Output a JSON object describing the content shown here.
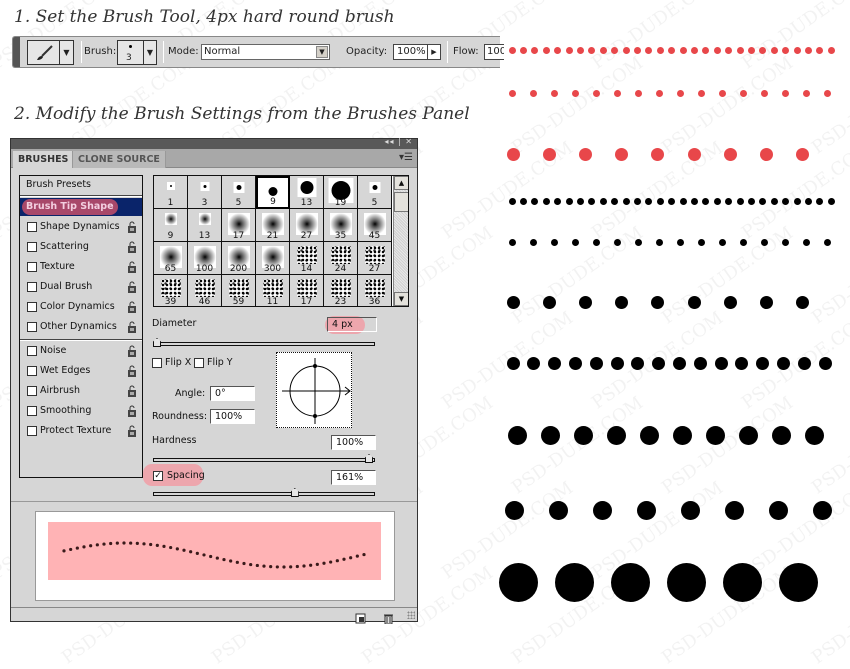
{
  "step1": {
    "title": "1. Set the Brush Tool, 4px hard round brush"
  },
  "step2": {
    "title": "2. Modify the Brush Settings from the Brushes Panel"
  },
  "options_bar": {
    "tool_icon": "brush-icon",
    "brush_label": "Brush:",
    "brush_size": "3",
    "mode_label": "Mode:",
    "mode_value": "Normal",
    "opacity_label": "Opacity:",
    "opacity_value": "100%",
    "flow_label": "Flow:",
    "flow_value": "100"
  },
  "panel": {
    "controls": "◂◂ | ✕",
    "tabs": [
      {
        "label": "BRUSHES",
        "active": true
      },
      {
        "label": "CLONE SOURCE",
        "active": false
      }
    ],
    "menu_icon": "panel-menu-icon",
    "presets_label": "Brush Presets",
    "selected_label": "Brush Tip Shape",
    "options": [
      {
        "label": "Shape Dynamics",
        "checked": false
      },
      {
        "label": "Scattering",
        "checked": false
      },
      {
        "label": "Texture",
        "checked": false
      },
      {
        "label": "Dual Brush",
        "checked": false
      },
      {
        "label": "Color Dynamics",
        "checked": false
      },
      {
        "label": "Other Dynamics",
        "checked": false
      },
      {
        "label": "Noise",
        "checked": false
      },
      {
        "label": "Wet Edges",
        "checked": false
      },
      {
        "label": "Airbrush",
        "checked": false
      },
      {
        "label": "Smoothing",
        "checked": false
      },
      {
        "label": "Protect Texture",
        "checked": false
      }
    ],
    "brush_tips": [
      {
        "size": "1",
        "kind": "hard"
      },
      {
        "size": "3",
        "kind": "hard"
      },
      {
        "size": "5",
        "kind": "hard"
      },
      {
        "size": "9",
        "kind": "hard",
        "selected": true
      },
      {
        "size": "13",
        "kind": "hard"
      },
      {
        "size": "19",
        "kind": "hard"
      },
      {
        "size": "5",
        "kind": "hard"
      },
      {
        "size": "9",
        "kind": "soft"
      },
      {
        "size": "13",
        "kind": "soft"
      },
      {
        "size": "17",
        "kind": "soft"
      },
      {
        "size": "21",
        "kind": "soft"
      },
      {
        "size": "27",
        "kind": "soft"
      },
      {
        "size": "35",
        "kind": "soft"
      },
      {
        "size": "45",
        "kind": "soft"
      },
      {
        "size": "65",
        "kind": "soft"
      },
      {
        "size": "100",
        "kind": "soft"
      },
      {
        "size": "200",
        "kind": "soft"
      },
      {
        "size": "300",
        "kind": "soft"
      },
      {
        "size": "14",
        "kind": "spatter"
      },
      {
        "size": "24",
        "kind": "spatter"
      },
      {
        "size": "27",
        "kind": "spatter"
      },
      {
        "size": "39",
        "kind": "spatter"
      },
      {
        "size": "46",
        "kind": "spatter"
      },
      {
        "size": "59",
        "kind": "spatter"
      },
      {
        "size": "11",
        "kind": "spatter"
      },
      {
        "size": "17",
        "kind": "spatter"
      },
      {
        "size": "23",
        "kind": "spatter"
      },
      {
        "size": "36",
        "kind": "spatter"
      }
    ],
    "diameter_label": "Diameter",
    "diameter_value": "4 px",
    "diameter_fraction": 0.0,
    "flip_x_label": "Flip X",
    "flip_y_label": "Flip Y",
    "angle_label": "Angle:",
    "angle_value": "0°",
    "roundness_label": "Roundness:",
    "roundness_value": "100%",
    "hardness_label": "Hardness",
    "hardness_value": "100%",
    "hardness_fraction": 1.0,
    "spacing_label": "Spacing",
    "spacing_checked": true,
    "spacing_value": "161%",
    "spacing_fraction": 0.65,
    "footer_icons": [
      "new-preset-icon",
      "trash-icon"
    ]
  },
  "samples": {
    "colors": {
      "red": "#e8474a",
      "black": "#000000"
    },
    "rows": [
      {
        "color": "red",
        "diameter": 4,
        "count": 29
      },
      {
        "color": "red",
        "diameter": 4,
        "count": 16
      },
      {
        "color": "red",
        "diameter": 9,
        "count": 9
      },
      {
        "color": "black",
        "diameter": 4,
        "count": 29
      },
      {
        "color": "black",
        "diameter": 4,
        "count": 16
      },
      {
        "color": "black",
        "diameter": 9,
        "count": 9
      },
      {
        "color": "black",
        "diameter": 9,
        "count": 16
      },
      {
        "color": "black",
        "diameter": 14,
        "count": 10
      },
      {
        "color": "black",
        "diameter": 14,
        "count": 8
      },
      {
        "color": "black",
        "diameter": 30,
        "count": 6
      }
    ]
  },
  "watermark": "PSD-DUDE.COM"
}
